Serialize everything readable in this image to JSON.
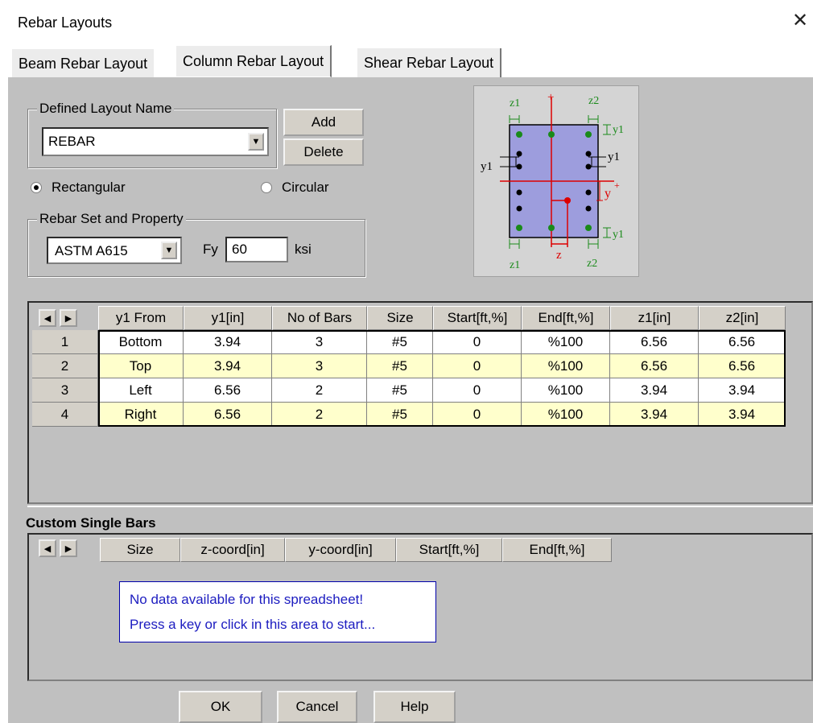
{
  "window": {
    "title": "Rebar Layouts"
  },
  "tabs": [
    "Beam Rebar Layout",
    "Column Rebar Layout",
    "Shear Rebar Layout"
  ],
  "layout_name": {
    "group_label": "Defined Layout Name",
    "value": "REBAR",
    "add_label": "Add",
    "delete_label": "Delete"
  },
  "shape": {
    "rectangular_label": "Rectangular",
    "circular_label": "Circular",
    "selected": "Rectangular"
  },
  "rebar_set": {
    "group_label": "Rebar Set and Property",
    "material": "ASTM A615",
    "fy_label": "Fy",
    "fy_value": "60",
    "fy_unit": "ksi"
  },
  "diagram": {
    "labels": {
      "z1": "z1",
      "z2": "z2",
      "y1": "y1",
      "y_plus": "y",
      "plus": "+",
      "z": "z"
    }
  },
  "rebar_table": {
    "columns": [
      "y1 From",
      "y1[in]",
      "No of Bars",
      "Size",
      "Start[ft,%]",
      "End[ft,%]",
      "z1[in]",
      "z2[in]"
    ],
    "rows": [
      {
        "num": "1",
        "cells": [
          "Bottom",
          "3.94",
          "3",
          "#5",
          "0",
          "%100",
          "6.56",
          "6.56"
        ]
      },
      {
        "num": "2",
        "cells": [
          "Top",
          "3.94",
          "3",
          "#5",
          "0",
          "%100",
          "6.56",
          "6.56"
        ]
      },
      {
        "num": "3",
        "cells": [
          "Left",
          "6.56",
          "2",
          "#5",
          "0",
          "%100",
          "3.94",
          "3.94"
        ]
      },
      {
        "num": "4",
        "cells": [
          "Right",
          "6.56",
          "2",
          "#5",
          "0",
          "%100",
          "3.94",
          "3.94"
        ]
      }
    ]
  },
  "custom_bars": {
    "title": "Custom Single Bars",
    "columns": [
      "Size",
      "z-coord[in]",
      "y-coord[in]",
      "Start[ft,%]",
      "End[ft,%]"
    ],
    "empty_line1": "No data available for this spreadsheet!",
    "empty_line2": "Press a key or click in this area to start..."
  },
  "footer": {
    "ok_label": "OK",
    "cancel_label": "Cancel",
    "help_label": "Help"
  },
  "colors": {
    "row_alt": "#ffffcc",
    "section_fill": "#9d9ddd",
    "rebar_green": "#1a8a1a",
    "axis_red": "#dd0000"
  }
}
